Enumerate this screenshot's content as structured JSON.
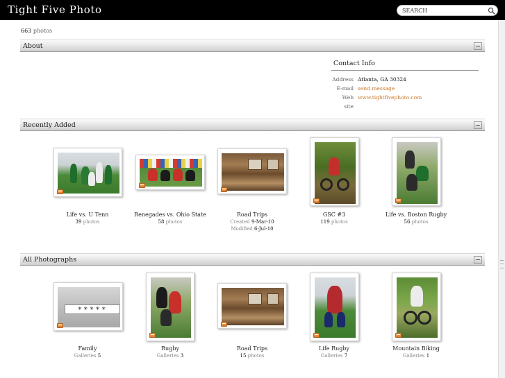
{
  "header": {
    "site_title": "Tight Five Photo",
    "search_placeholder": "SEARCH"
  },
  "photo_count": {
    "number": "663",
    "label": "photos"
  },
  "sections": {
    "about": "About",
    "recently_added": "Recently Added",
    "all_photographs": "All Photographs"
  },
  "contact": {
    "title": "Contact Info",
    "rows": [
      {
        "label": "Address",
        "value": "Atlanta, GA 30324"
      },
      {
        "label": "E-mail",
        "value": "send message"
      },
      {
        "label": "Web site",
        "value": "www.tightfivephoto.com"
      }
    ]
  },
  "recent": [
    {
      "title": "Life vs. U Tenn",
      "count": "39",
      "unit": "photos"
    },
    {
      "title": "Renegades vs. Ohio State",
      "count": "58",
      "unit": "photos"
    },
    {
      "title": "Road Trips",
      "created_label": "Created",
      "created": "9-Mar-10",
      "modified_label": "Modified",
      "modified": "6-Jul-10"
    },
    {
      "title": "GSC #3",
      "count": "119",
      "unit": "photos"
    },
    {
      "title": "Life vs. Boston Rugby",
      "count": "56",
      "unit": "photos"
    }
  ],
  "all": [
    {
      "title": "Family",
      "unit": "Galleries",
      "count": "5",
      "lock_text": "*****"
    },
    {
      "title": "Rugby",
      "unit": "Galleries",
      "count": "3"
    },
    {
      "title": "Road Trips",
      "count": "15",
      "unit": "photos"
    },
    {
      "title": "Life Rugby",
      "unit": "Galleries",
      "count": "7"
    },
    {
      "title": "Mountain Biking",
      "unit": "Galleries",
      "count": "1"
    }
  ],
  "colors": {
    "header_bg": "#000000",
    "link": "#c8782c",
    "badge": "#e88a2e"
  },
  "icons": {
    "search": "search-icon",
    "gallery_badge": "gallery-icon",
    "collapse": "collapse-icon"
  }
}
